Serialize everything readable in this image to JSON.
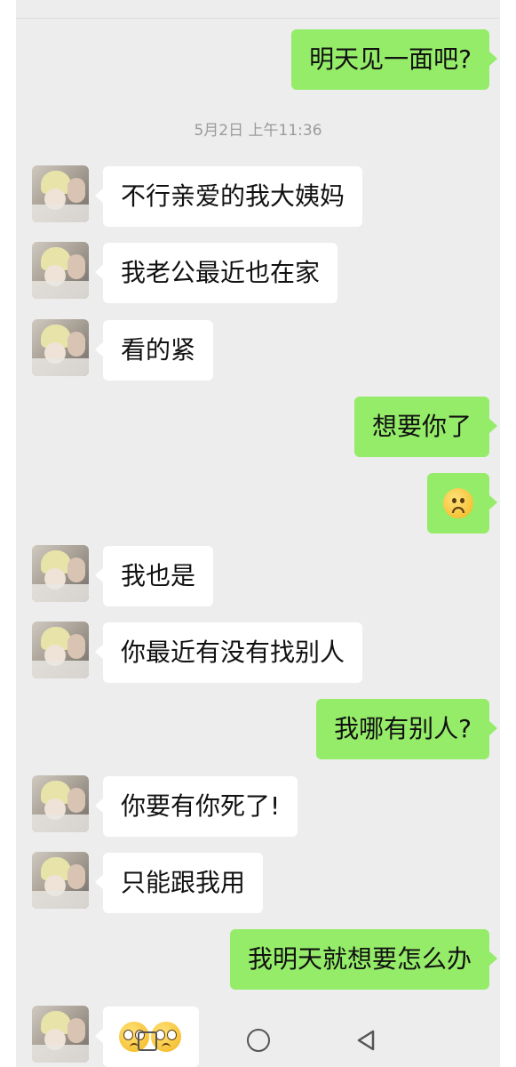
{
  "timestamp": "5月2日 上午11:36",
  "messages": [
    {
      "side": "out",
      "text": "明天见一面吧?"
    },
    {
      "side": "in",
      "text": "不行亲爱的我大姨妈"
    },
    {
      "side": "in",
      "text": "我老公最近也在家"
    },
    {
      "side": "in",
      "text": "看的紧"
    },
    {
      "side": "out",
      "text": "想要你了"
    },
    {
      "side": "out",
      "emoji": "frowning-face"
    },
    {
      "side": "in",
      "text": "我也是"
    },
    {
      "side": "in",
      "text": "你最近有没有找别人"
    },
    {
      "side": "out",
      "text": "我哪有别人?"
    },
    {
      "side": "in",
      "text": "你要有你死了!"
    },
    {
      "side": "in",
      "text": "只能跟我用"
    },
    {
      "side": "out",
      "text": "我明天就想要怎么办"
    },
    {
      "side": "in",
      "emoji": "pleading-face x2"
    }
  ],
  "navigation": {
    "buttons": [
      "recent-apps-icon",
      "home-icon",
      "back-icon"
    ]
  },
  "colors": {
    "chat_background": "#ededed",
    "outgoing_bubble": "#95ec69",
    "incoming_bubble": "#ffffff",
    "timestamp_text": "#9b9b9b"
  }
}
